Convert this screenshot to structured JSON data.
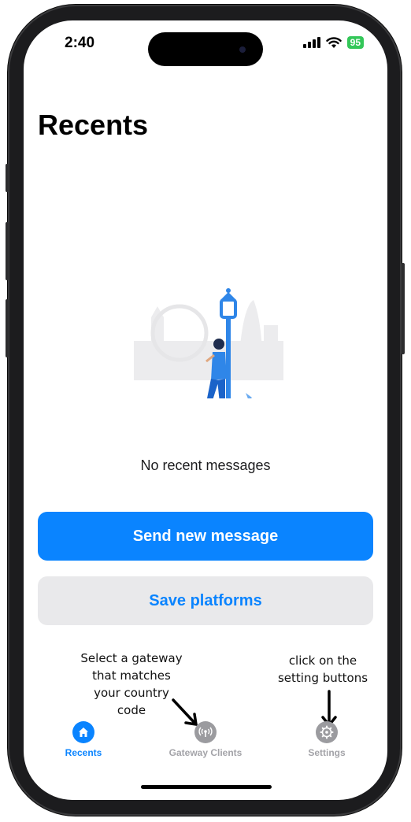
{
  "status_bar": {
    "time": "2:40",
    "battery": "95",
    "icons": [
      "cellular-signal-icon",
      "wifi-icon",
      "battery-icon"
    ]
  },
  "page": {
    "title": "Recents",
    "empty_state_text": "No recent messages",
    "illustration": "person-leaning-on-lamppost-illustration"
  },
  "actions": {
    "send_label": "Send new message",
    "save_label": "Save platforms"
  },
  "annotations": {
    "gateway_hint": "Select a gateway\nthat matches\nyour country\ncode",
    "settings_hint": "click on the\nsetting buttons"
  },
  "tabbar": {
    "recents": {
      "label": "Recents",
      "icon": "home-icon",
      "active": true
    },
    "gateway": {
      "label": "Gateway Clients",
      "icon": "antenna-icon",
      "active": false
    },
    "settings": {
      "label": "Settings",
      "icon": "gear-icon",
      "active": false
    }
  },
  "colors": {
    "accent": "#0a84ff",
    "secondary_button_bg": "#e9e9eb",
    "inactive_tab": "#9b9b9f",
    "battery": "#34c759"
  }
}
